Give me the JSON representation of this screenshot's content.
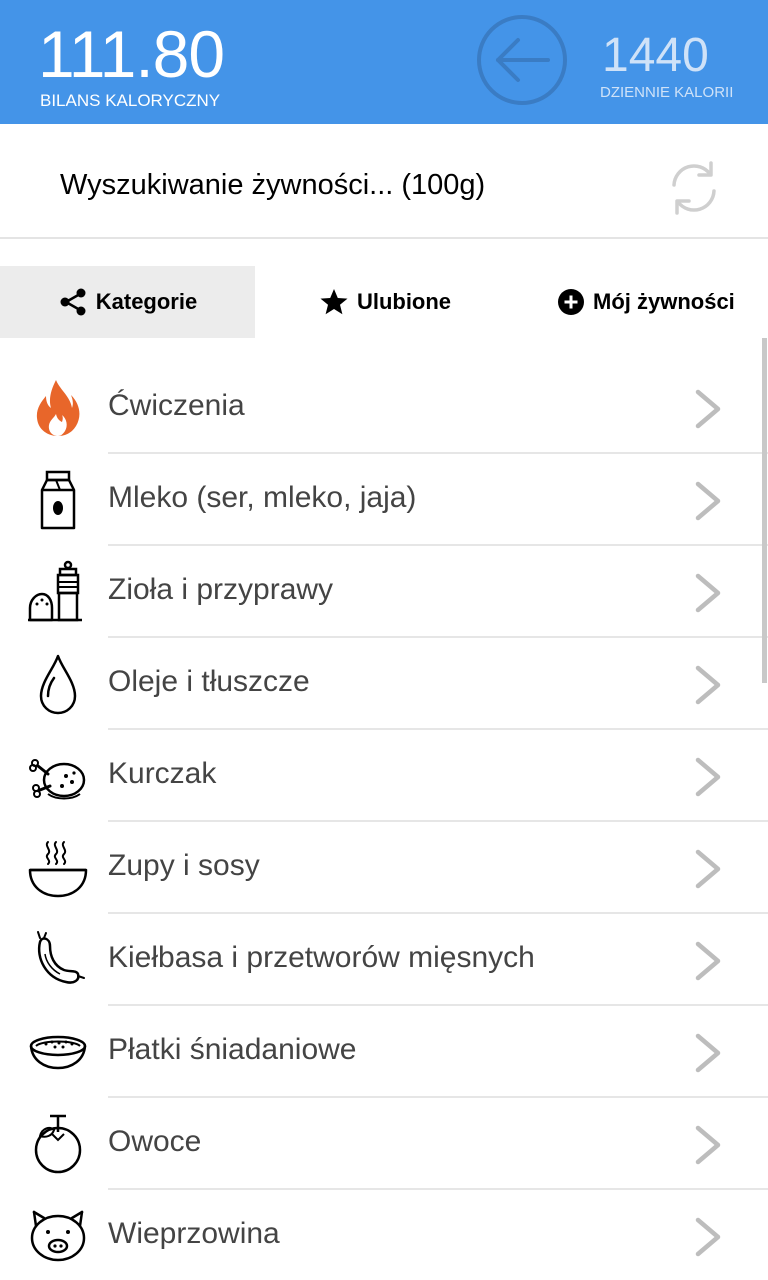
{
  "header": {
    "balance_value": "111.80",
    "balance_label": "BILANS KALORYCZNY",
    "daily_value": "1440",
    "daily_label": "DZIENNIE KALORII",
    "back_icon": "arrow-left-circle-icon",
    "background_color": "#4494e8"
  },
  "search": {
    "text": "Wyszukiwanie żywności... (100g)",
    "refresh_icon": "refresh-icon"
  },
  "tabs": [
    {
      "label": "Kategorie",
      "icon": "share-icon",
      "active": true
    },
    {
      "label": "Ulubione",
      "icon": "star-icon",
      "active": false
    },
    {
      "label": "Mój żywności",
      "icon": "plus-circle-icon",
      "active": false
    }
  ],
  "categories": [
    {
      "label": "Ćwiczenia",
      "icon": "flame-icon"
    },
    {
      "label": "Mleko (ser, mleko, jaja)",
      "icon": "milk-carton-icon"
    },
    {
      "label": "Zioła i przyprawy",
      "icon": "spice-grinder-icon"
    },
    {
      "label": "Oleje i tłuszcze",
      "icon": "oil-drop-icon"
    },
    {
      "label": "Kurczak",
      "icon": "roast-chicken-icon"
    },
    {
      "label": "Zupy i sosy",
      "icon": "soup-bowl-icon"
    },
    {
      "label": "Kiełbasa i przetworów mięsnych",
      "icon": "sausage-icon"
    },
    {
      "label": "Płatki śniadaniowe",
      "icon": "cereal-bowl-icon"
    },
    {
      "label": "Owoce",
      "icon": "fruit-icon"
    },
    {
      "label": "Wieprzowina",
      "icon": "pig-icon"
    }
  ]
}
